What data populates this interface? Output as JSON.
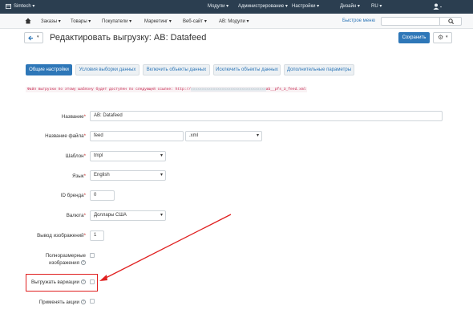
{
  "topbar": {
    "brand": "Simtech",
    "menus": [
      "Модули",
      "Администрирование",
      "Настройки",
      "Дизайн",
      "RU"
    ]
  },
  "navbar": {
    "items": [
      "Заказы",
      "Товары",
      "Покупатели",
      "Маркетинг",
      "Веб-сайт",
      "AB: Модули"
    ],
    "quick_menu": "Быстрое меню"
  },
  "header": {
    "title": "Редактировать выгрузку: AB: Datafeed",
    "save_label": "Сохранить"
  },
  "tabs": [
    "Общие настройки",
    "Условия выборки данных",
    "Включить объекты данных",
    "Исключить объекты данных",
    "Дополнительные параметры"
  ],
  "notice": {
    "prefix": "Файл выгрузки по этому шаблону будет доступен по следующей ссылке: http://",
    "hidden": "xxxxxxxxxxxxxxxxxxxxxxxxxxxxxxxxxx",
    "suffix": "ab__pfs_3_feed.xml"
  },
  "form": {
    "name_label": "Название",
    "name_value": "AB: Datafeed",
    "filename_label": "Название файла",
    "filename_value": "feed",
    "filename_ext": ".xml",
    "template_label": "Шаблон",
    "template_value": "tmpl",
    "lang_label": "Язык",
    "lang_value": "English",
    "brand_label": "ID бренда",
    "brand_value": "0",
    "currency_label": "Валюта",
    "currency_value": "Доллары США",
    "images_label": "Вывод изображений",
    "images_value": "1",
    "fullsize_label_1": "Полноразмерные",
    "fullsize_label_2": "изображения",
    "variations_label": "Выгружать вариации",
    "promo_label": "Применять акции"
  },
  "colors": {
    "accent": "#2e77b8",
    "topbar": "#2b3e50",
    "highlight": "#e02020"
  }
}
